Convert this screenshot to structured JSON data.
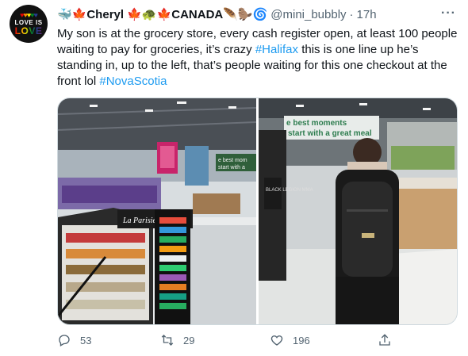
{
  "author": {
    "display_name": "🐳🍁Cheryl 🍁🐢🍁CANADA🪶🦫🌀",
    "handle": "@mini_bubbly",
    "separator": "·",
    "time": "17h",
    "avatar_line1": "LOVE IS",
    "avatar_line2": "LOVE"
  },
  "tweet": {
    "text_before": "My son is at the grocery store, every cash register open, at least 100 people waiting to pay for groceries, it’s crazy ",
    "hashtag1": "#Halifax",
    "text_middle": " this is one line up he’s standing in, up to the left, that’s people waiting for this one checkout at the front lol ",
    "hashtag2": "#NovaScotia"
  },
  "media": {
    "left_sign": "La Parisienne",
    "right_banner_line1": "e best moments",
    "right_banner_line2": "start with a great meal",
    "left_banner_line1": "e best mom",
    "left_banner_line2": "start with a",
    "shirt_text": "BLACK LEGION MMA"
  },
  "actions": {
    "replies": "53",
    "retweets": "29",
    "likes": "196"
  },
  "more_icon": "···",
  "colors": {
    "link": "#1d9bf0",
    "muted": "#536471",
    "border": "#cfd9de"
  }
}
